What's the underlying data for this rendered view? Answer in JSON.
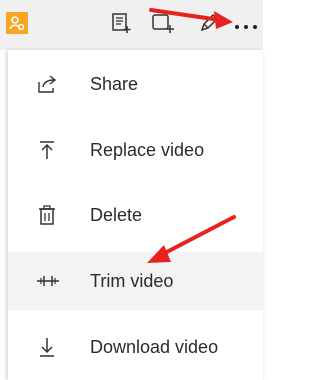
{
  "toolbar": {
    "icons": [
      "user-icon",
      "list-add-icon",
      "add-frame-icon",
      "pen-icon",
      "more-options-icon"
    ],
    "accent": "#f5a623"
  },
  "menu": {
    "items": [
      {
        "label": "Share",
        "icon": "share-icon"
      },
      {
        "label": "Replace video",
        "icon": "upload-icon"
      },
      {
        "label": "Delete",
        "icon": "trash-icon"
      },
      {
        "label": "Trim video",
        "icon": "trim-icon"
      },
      {
        "label": "Download video",
        "icon": "download-icon"
      }
    ]
  },
  "annotations": {
    "arrow_color": "#e8231f"
  }
}
